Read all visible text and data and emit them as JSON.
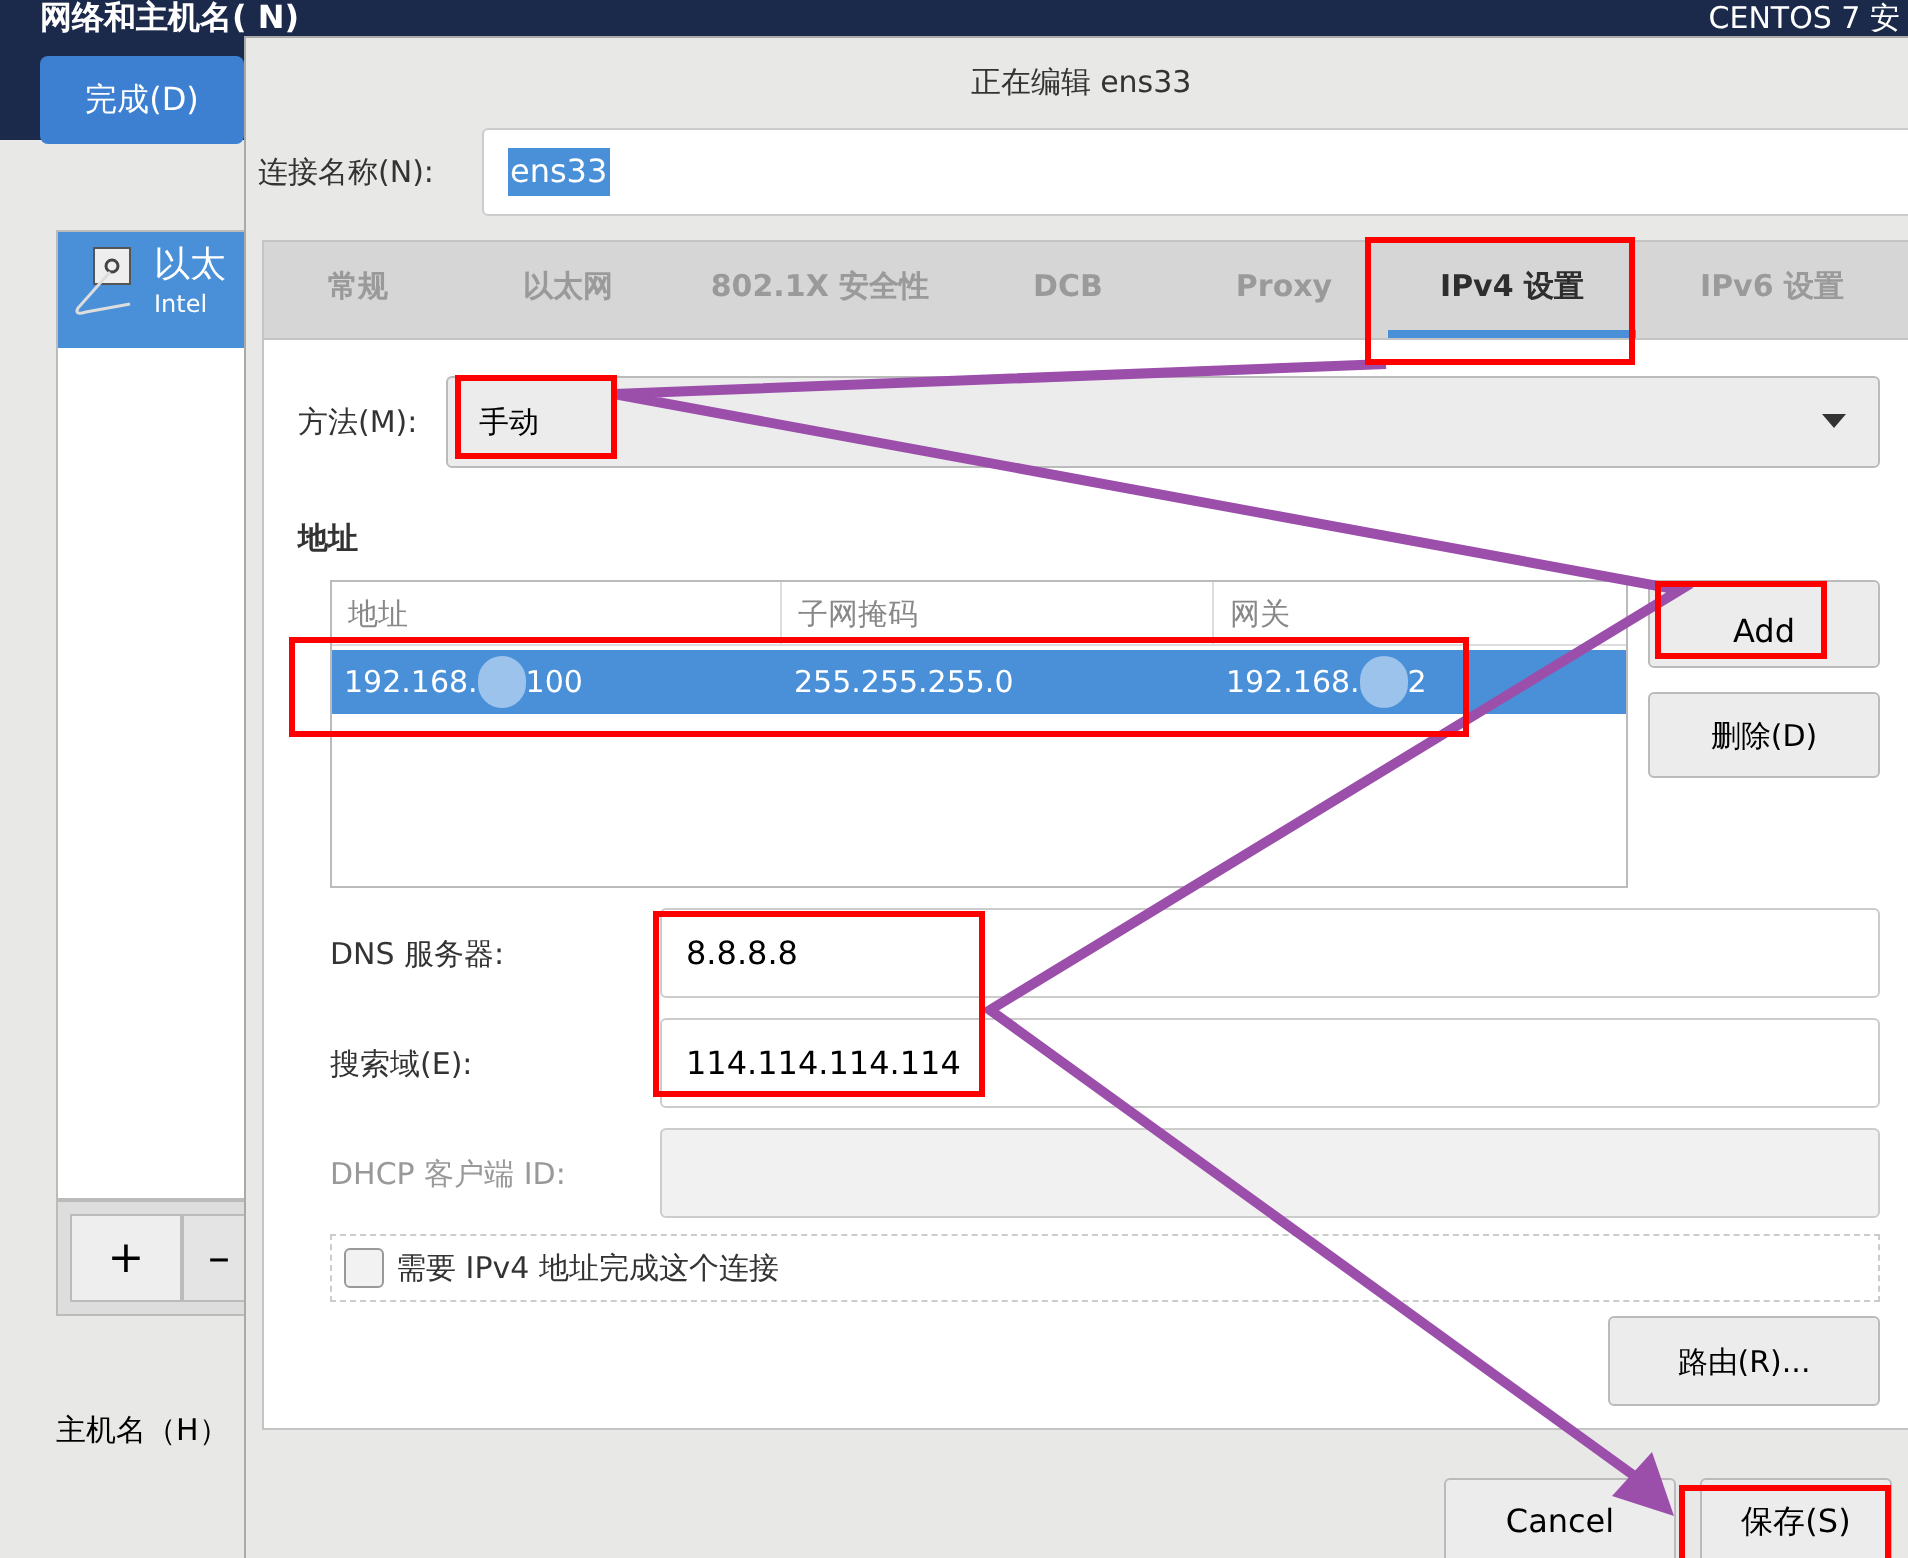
{
  "installer": {
    "title": "网络和主机名( N)",
    "done_button": "完成(D)",
    "product": "CENTOS 7 安",
    "devices": [
      {
        "name": "以太",
        "detail": "Intel",
        "selected": true
      }
    ],
    "add_button": "+",
    "remove_button": "–",
    "hostname_label": "主机名（H）"
  },
  "dialog": {
    "title": "正在编辑 ens33",
    "connection_name": {
      "label": "连接名称(N):",
      "value": "ens33"
    },
    "tabs": [
      {
        "label": "常规",
        "selected": false
      },
      {
        "label": "以太网",
        "selected": false
      },
      {
        "label": "802.1X 安全性",
        "selected": false
      },
      {
        "label": "DCB",
        "selected": false
      },
      {
        "label": "Proxy",
        "selected": false
      },
      {
        "label": "IPv4 设置",
        "selected": true
      },
      {
        "label": "IPv6 设置",
        "selected": false
      }
    ],
    "method": {
      "label": "方法(M):",
      "value": "手动"
    },
    "addresses": {
      "heading": "地址",
      "columns": [
        "地址",
        "子网掩码",
        "网关"
      ],
      "rows": [
        {
          "selected": true,
          "cells": [
            [
              "192.168.",
              "100"
            ],
            [
              "255.255.255.0"
            ],
            [
              "192.168.",
              "2"
            ]
          ]
        }
      ],
      "add_button": "Add",
      "delete_button": "删除(D)"
    },
    "fields": [
      {
        "label": "DNS 服务器:",
        "value": "8.8.8.8",
        "disabled": false
      },
      {
        "label": "搜索域(E):",
        "value": "114.114.114.114",
        "disabled": false
      },
      {
        "label": "DHCP 客户端 ID:",
        "disabled": true
      }
    ],
    "require_ipv4": {
      "label": "需要 IPv4 地址完成这个连接",
      "checked": false
    },
    "routes_button": "路由(R)...",
    "buttons": [
      {
        "label": "Cancel"
      },
      {
        "label": "保存(S)"
      }
    ]
  }
}
